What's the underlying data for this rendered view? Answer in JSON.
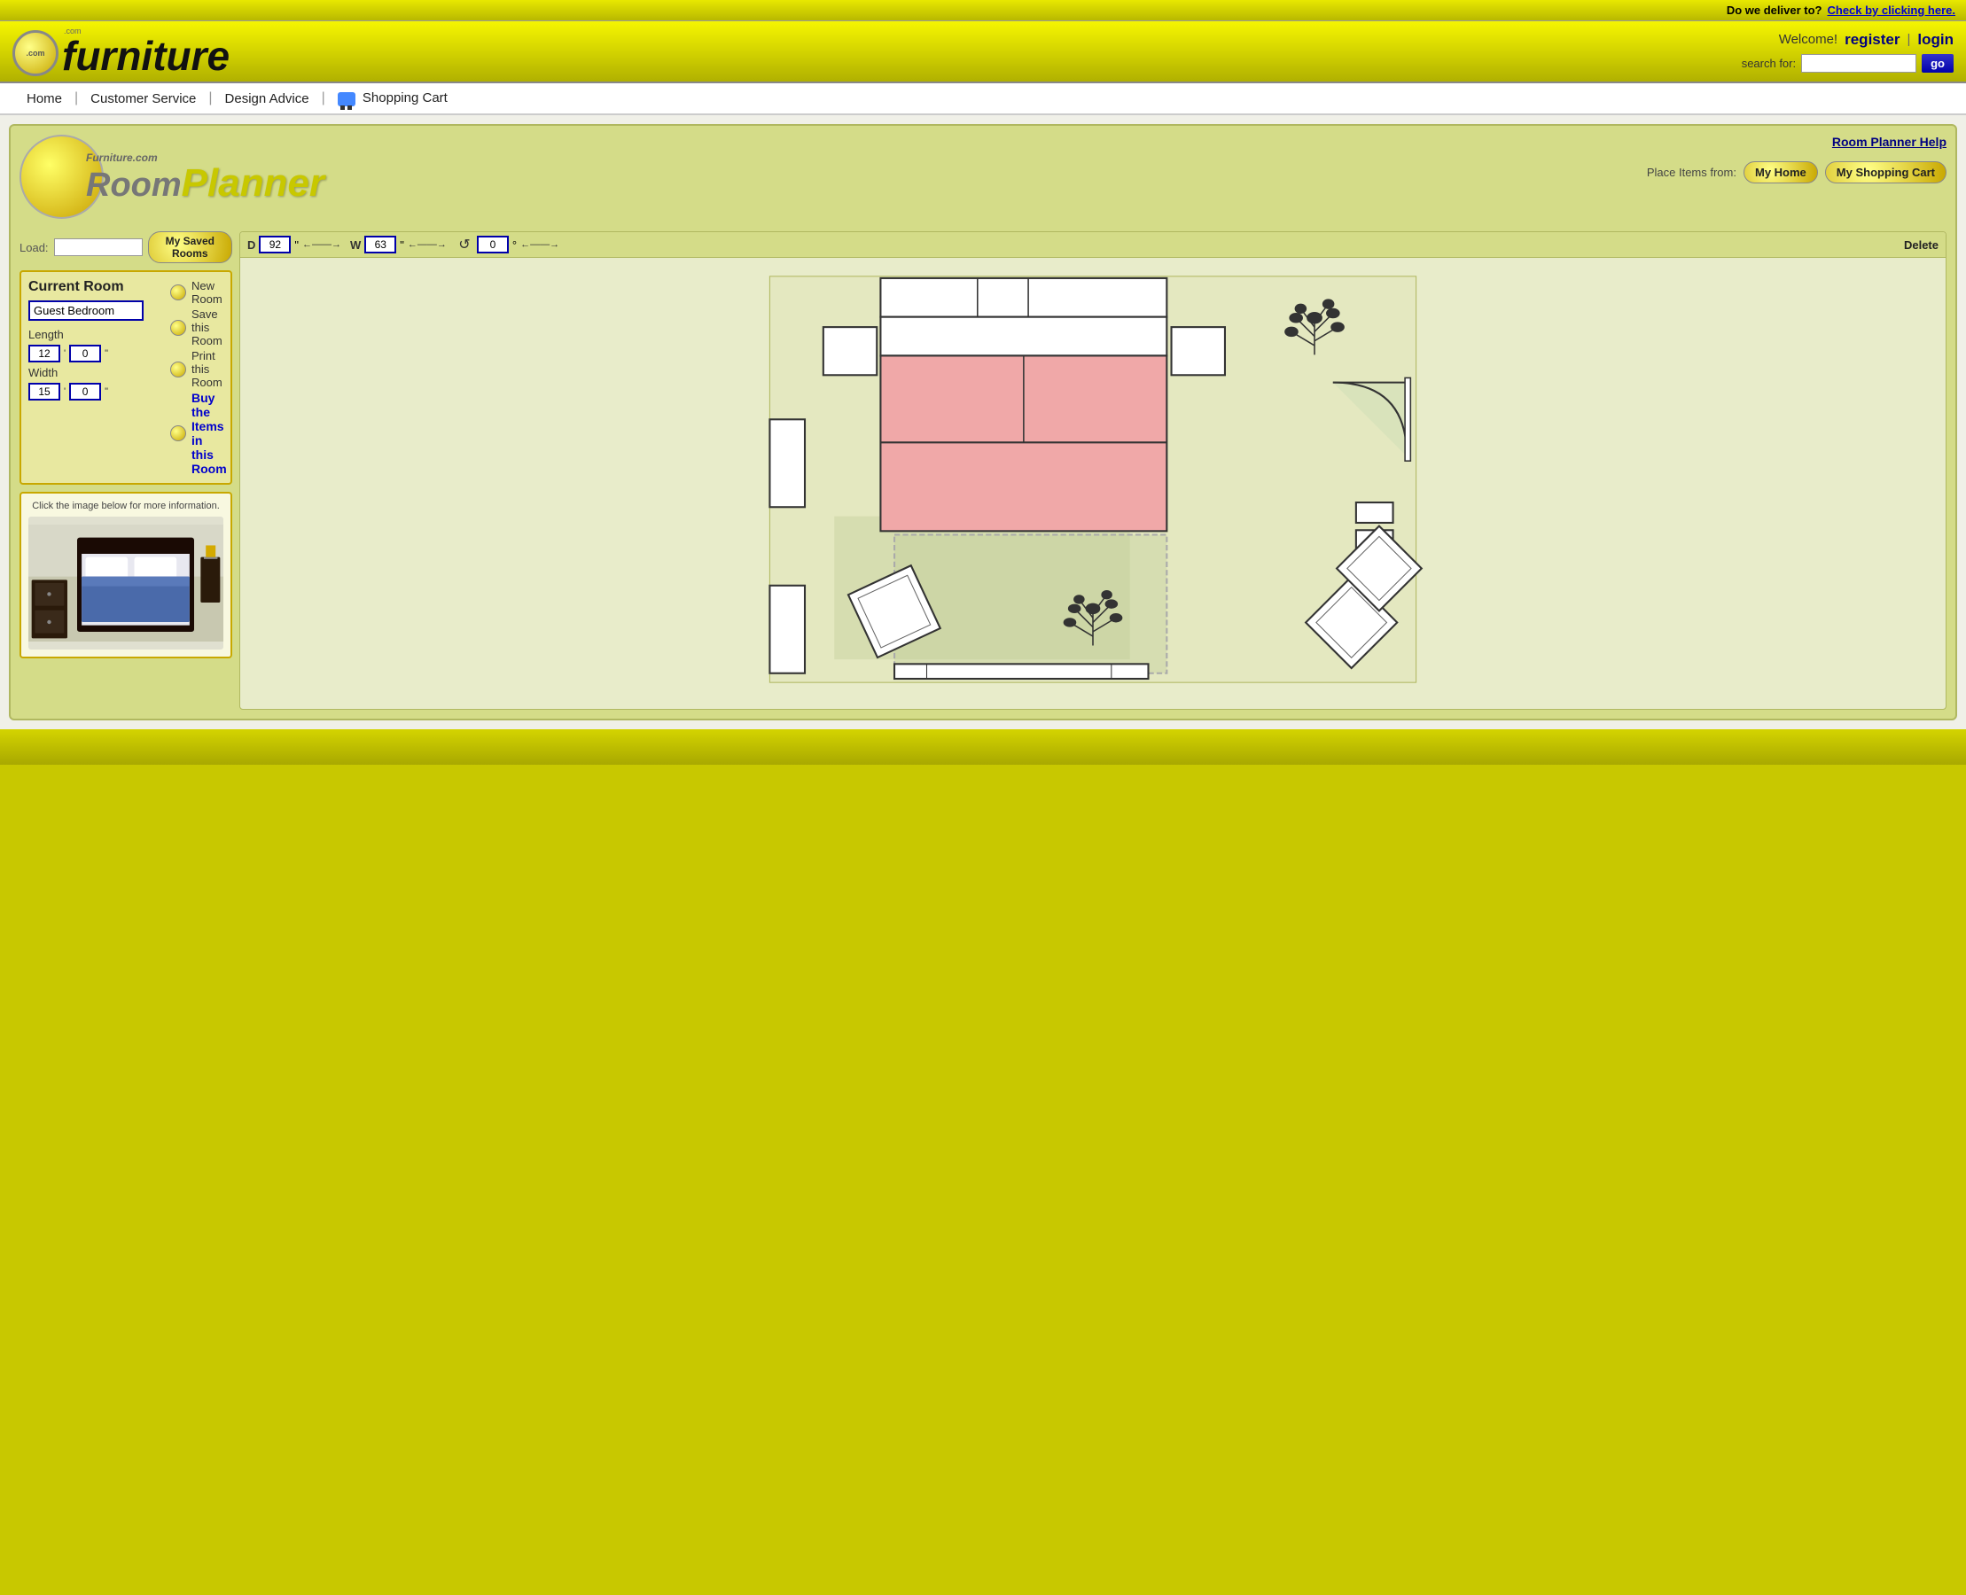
{
  "topbar": {
    "deliver_text": "Do we deliver to?",
    "check_link": "Check by clicking here."
  },
  "header": {
    "logo_com": ".com",
    "logo_name": "furniture",
    "welcome": "Welcome!",
    "register": "register",
    "pipe": "|",
    "login": "login",
    "search_label": "search for:",
    "search_value": "",
    "go_label": "go"
  },
  "nav": {
    "home": "Home",
    "customer_service": "Customer Service",
    "design_advice": "Design Advice",
    "shopping_cart": "Shopping Cart"
  },
  "planner": {
    "furniture_com_small": "Furniture.com",
    "room_text": "Room",
    "planner_text": "Planner",
    "help_link": "Room Planner Help",
    "place_items_from": "Place Items from:",
    "my_home": "My Home",
    "my_shopping_cart": "My Shopping Cart"
  },
  "toolbar": {
    "d_label": "D",
    "d_value": "92",
    "d_unit": "\"",
    "w_label": "W",
    "w_value": "63",
    "w_unit": "\"",
    "rotate_value": "0",
    "rotate_unit": "°",
    "delete_label": "Delete"
  },
  "left_panel": {
    "load_label": "Load:",
    "my_saved_rooms": "My Saved Rooms",
    "current_room_title": "Current Room",
    "room_name_value": "Guest Bedroom",
    "length_label": "Length",
    "length_ft": "12",
    "length_in": "0",
    "width_label": "Width",
    "width_ft": "15",
    "width_in": "0",
    "new_room": "New Room",
    "save_room": "Save this Room",
    "print_room": "Print this Room",
    "buy_items": "Buy the Items",
    "in_this_room": "in this Room",
    "preview_text": "Click the image below for more information."
  }
}
